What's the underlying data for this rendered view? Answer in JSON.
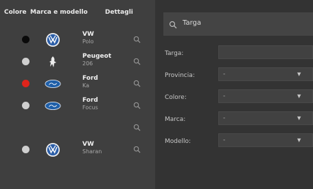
{
  "left_panel": {
    "headers": [
      "Colore",
      "Marca e modello",
      "Dettagli"
    ],
    "rows": [
      {
        "color": "#0a0a0a",
        "brand_icon": "vw-logo-icon",
        "make": "VW",
        "model": "Polo",
        "has_car": true
      },
      {
        "color": "#cfcfcf",
        "brand_icon": "peugeot-logo-icon",
        "make": "Peugeot",
        "model": "206",
        "has_car": true
      },
      {
        "color": "#e0241b",
        "brand_icon": "ford-logo-icon",
        "make": "Ford",
        "model": "Ka",
        "has_car": true
      },
      {
        "color": "#cfcfcf",
        "brand_icon": "ford-logo-icon",
        "make": "Ford",
        "model": "Focus",
        "has_car": true
      },
      {
        "color": "",
        "brand_icon": "",
        "make": "",
        "model": "",
        "has_car": false
      },
      {
        "color": "#cfcfcf",
        "brand_icon": "vw-logo-icon",
        "make": "VW",
        "model": "Sharan",
        "has_car": true
      }
    ]
  },
  "right_panel": {
    "search": {
      "label": "Targa"
    },
    "form": [
      {
        "label": "Targa:",
        "value": "",
        "type": "text"
      },
      {
        "label": "Provincia:",
        "value": "-",
        "type": "select"
      },
      {
        "label": "Colore:",
        "value": "-",
        "type": "select"
      },
      {
        "label": "Marca:",
        "value": "-",
        "type": "select"
      },
      {
        "label": "Modello:",
        "value": "-",
        "type": "select"
      }
    ]
  }
}
